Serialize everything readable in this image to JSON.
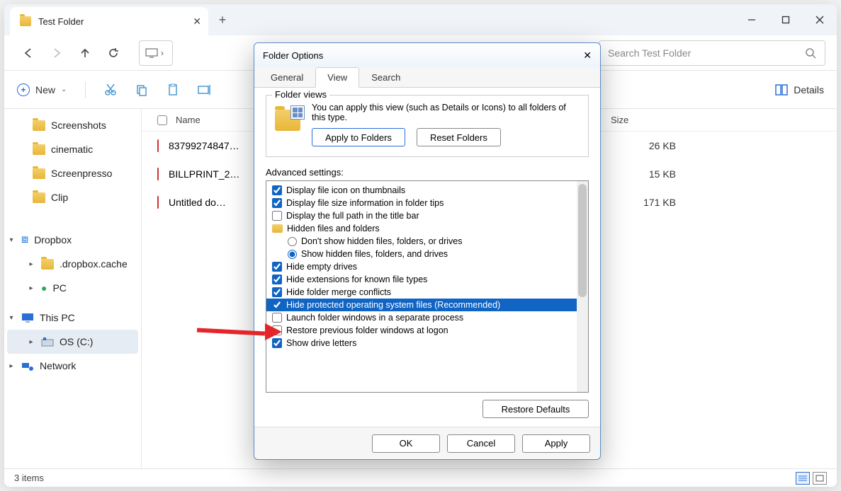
{
  "window": {
    "tab_title": "Test Folder",
    "search_placeholder": "Search Test Folder"
  },
  "toolbar": {
    "new_label": "New",
    "details_label": "Details"
  },
  "sidebar": {
    "items": [
      {
        "label": "Screenshots"
      },
      {
        "label": "cinematic"
      },
      {
        "label": "Screenpresso"
      },
      {
        "label": "Clip"
      }
    ],
    "dropbox": "Dropbox",
    "dropbox_cache": ".dropbox.cache",
    "pc1": "PC",
    "this_pc": "This PC",
    "osc": "OS (C:)",
    "network": "Network"
  },
  "columns": {
    "name": "Name",
    "size": "Size"
  },
  "files": [
    {
      "name": "83799274847…",
      "size": "26 KB"
    },
    {
      "name": "BILLPRINT_2…",
      "size": "15 KB"
    },
    {
      "name": "Untitled do…",
      "size": "171 KB"
    }
  ],
  "status": {
    "count": "3 items"
  },
  "dialog": {
    "title": "Folder Options",
    "tabs": [
      "General",
      "View",
      "Search"
    ],
    "folder_views": {
      "legend": "Folder views",
      "text": "You can apply this view (such as Details or Icons) to all folders of this type.",
      "apply": "Apply to Folders",
      "reset": "Reset Folders"
    },
    "adv_label": "Advanced settings:",
    "adv": [
      {
        "t": "check",
        "c": true,
        "l": "Display file icon on thumbnails"
      },
      {
        "t": "check",
        "c": true,
        "l": "Display file size information in folder tips"
      },
      {
        "t": "check",
        "c": false,
        "l": "Display the full path in the title bar"
      },
      {
        "t": "folder",
        "l": "Hidden files and folders"
      },
      {
        "t": "radio",
        "c": false,
        "l": "Don't show hidden files, folders, or drives",
        "ind": true
      },
      {
        "t": "radio",
        "c": true,
        "l": "Show hidden files, folders, and drives",
        "ind": true
      },
      {
        "t": "check",
        "c": true,
        "l": "Hide empty drives"
      },
      {
        "t": "check",
        "c": true,
        "l": "Hide extensions for known file types"
      },
      {
        "t": "check",
        "c": true,
        "l": "Hide folder merge conflicts"
      },
      {
        "t": "check",
        "c": true,
        "l": "Hide protected operating system files (Recommended)",
        "sel": true
      },
      {
        "t": "check",
        "c": false,
        "l": "Launch folder windows in a separate process"
      },
      {
        "t": "check",
        "c": false,
        "l": "Restore previous folder windows at logon"
      },
      {
        "t": "check",
        "c": true,
        "l": "Show drive letters"
      }
    ],
    "restore": "Restore Defaults",
    "ok": "OK",
    "cancel": "Cancel",
    "apply": "Apply"
  }
}
